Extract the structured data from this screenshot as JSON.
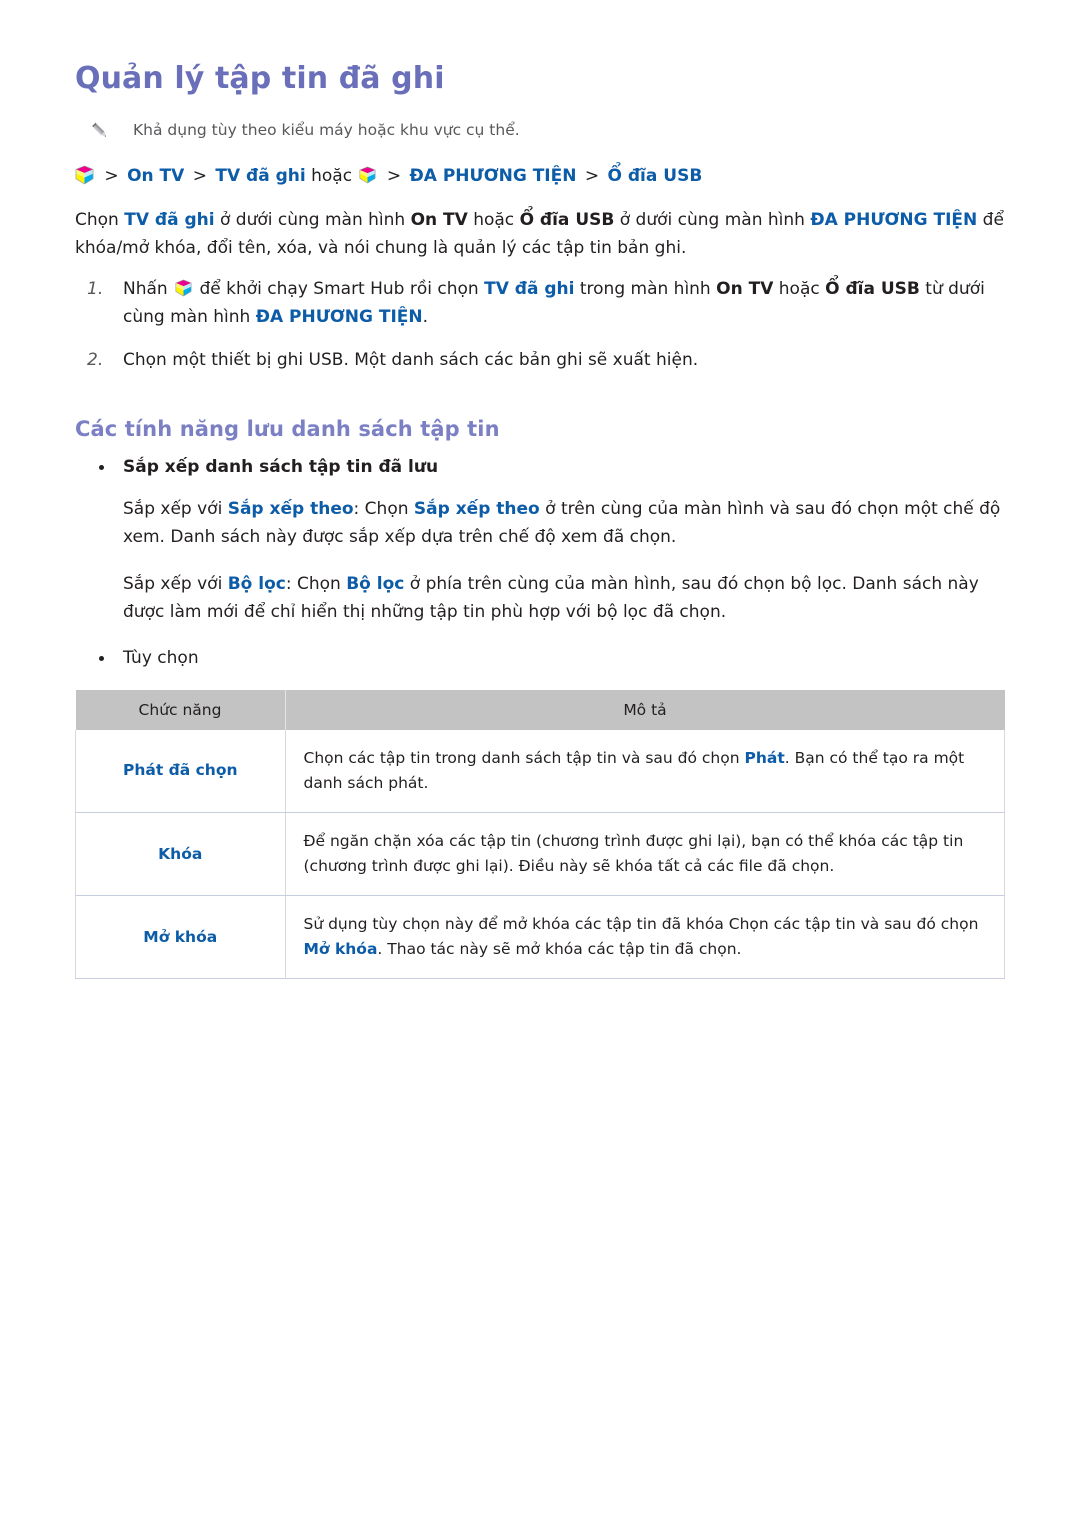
{
  "colors": {
    "title_purple": "#6a6fba",
    "section_purple": "#7b7fc4",
    "accent_blue": "#0d5ca8",
    "table_header_gray": "#c3c3c3",
    "row_divider": "#c9cde0",
    "note_gray": "#58585b"
  },
  "page": {
    "title": "Quản lý tập tin đã ghi",
    "note": "Khả dụng tùy theo kiểu máy hoặc khu vực cụ thể."
  },
  "breadcrumb": {
    "icon": "smart-hub-cube-icon",
    "sep": ">",
    "item1": "On TV",
    "item2": "TV đã ghi",
    "conjunction": "hoặc",
    "item3": "ĐA PHƯƠNG TIỆN",
    "item4": "Ổ đĩa USB"
  },
  "intro": {
    "t1": "Chọn ",
    "b1": "TV đã ghi",
    "t2": " ở dưới cùng màn hình ",
    "b2": "On TV",
    "t3": " hoặc ",
    "b3": "Ổ đĩa USB",
    "t4": " ở dưới cùng màn hình ",
    "b4": "ĐA PHƯƠNG TIỆN",
    "t5": " để khóa/mở khóa, đổi tên, xóa, và nói chung là quản lý các tập tin bản ghi."
  },
  "steps": [
    {
      "num": "1.",
      "t1": "Nhấn ",
      "icon": "smart-hub-cube-icon",
      "t2": " để khởi chạy Smart Hub rồi chọn ",
      "b1": "TV đã ghi",
      "t3": " trong màn hình ",
      "b2": "On TV",
      "t4": " hoặc ",
      "b3": "Ổ đĩa USB",
      "t5": " từ dưới cùng màn hình ",
      "b4": "ĐA PHƯƠNG TIỆN",
      "t6": "."
    },
    {
      "num": "2.",
      "t1": "Chọn một thiết bị ghi USB. Một danh sách các bản ghi sẽ xuất hiện."
    }
  ],
  "section": {
    "title": "Các tính năng lưu danh sách tập tin",
    "bullet1": "Sắp xếp danh sách tập tin đã lưu",
    "bullet2": "Tùy chọn",
    "para1": {
      "t1": "Sắp xếp với ",
      "b1": "Sắp xếp theo",
      "t2": ": Chọn ",
      "b2": "Sắp xếp theo",
      "t3": " ở trên cùng của màn hình và sau đó chọn một chế độ xem. Danh sách này được sắp xếp dựa trên chế độ xem đã chọn."
    },
    "para2": {
      "t1": "Sắp xếp với ",
      "b1": "Bộ lọc",
      "t2": ": Chọn ",
      "b2": "Bộ lọc",
      "t3": " ở phía trên cùng của màn hình, sau đó chọn bộ lọc. Danh sách này được làm mới để chỉ hiển thị những tập tin phù hợp với bộ lọc đã chọn."
    }
  },
  "table": {
    "headers": {
      "function": "Chức năng",
      "description": "Mô tả"
    },
    "rows": [
      {
        "function": "Phát đã chọn",
        "t1": "Chọn các tập tin trong danh sách tập tin và sau đó chọn ",
        "b1": "Phát",
        "t2": ". Bạn có thể tạo ra một danh sách phát.",
        "b2": "",
        "t3": ""
      },
      {
        "function": "Khóa",
        "t1": "Để ngăn chặn xóa các tập tin (chương trình được ghi lại), bạn có thể khóa các tập tin (chương trình được ghi lại). Điều này sẽ khóa tất cả các file đã chọn.",
        "b1": "",
        "t2": "",
        "b2": "",
        "t3": ""
      },
      {
        "function": "Mở khóa",
        "t1": "Sử dụng tùy chọn này để mở khóa các tập tin đã khóa Chọn các tập tin và sau đó chọn ",
        "b1": "Mở khóa",
        "t2": ". Thao tác này sẽ mở khóa các tập tin đã chọn.",
        "b2": "",
        "t3": ""
      }
    ]
  }
}
